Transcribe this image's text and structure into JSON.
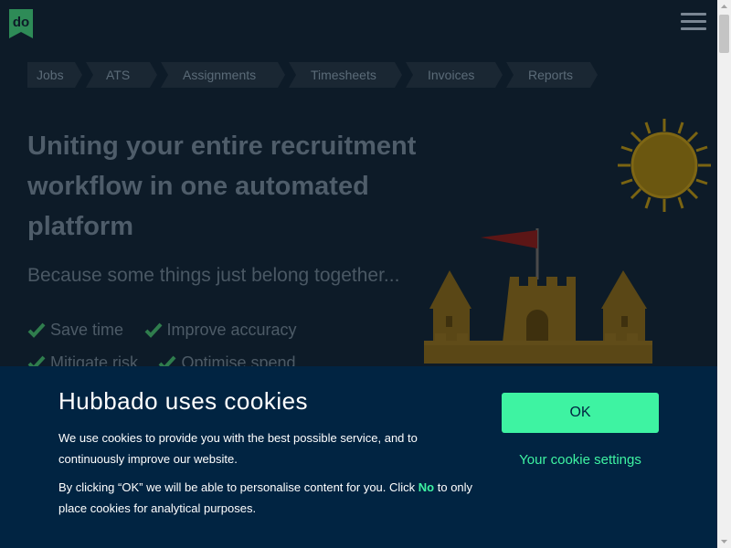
{
  "brand": {
    "logo_text": "do",
    "logo_color": "#2e8b57"
  },
  "nav": {
    "breadcrumb": [
      "Jobs",
      "ATS",
      "Assignments",
      "Timesheets",
      "Invoices",
      "Reports"
    ]
  },
  "hero": {
    "headline": "Uniting your entire recruitment workflow in one automated platform",
    "subline": "Because some things just belong together...",
    "benefits": [
      "Save time",
      "Improve accuracy",
      "Mitigate risk",
      "Optimise spend"
    ]
  },
  "cookie_banner": {
    "title": "Hubbado uses cookies",
    "paragraph1": "We use cookies to provide you with the best possible service, and to continuously improve our website.",
    "paragraph2_before": "By clicking “OK” we will be able to personalise content for you. Click ",
    "paragraph2_link": "No",
    "paragraph2_after": " to only place cookies for analytical purposes.",
    "ok_label": "OK",
    "settings_label": "Your cookie settings",
    "accent_color": "#3ef3a2",
    "background_color": "#012442"
  },
  "icons": {
    "menu": "hamburger-menu-icon",
    "benefit": "check-icon",
    "illustration_sun": "sun-icon",
    "illustration_castle": "sandcastle-icon"
  }
}
